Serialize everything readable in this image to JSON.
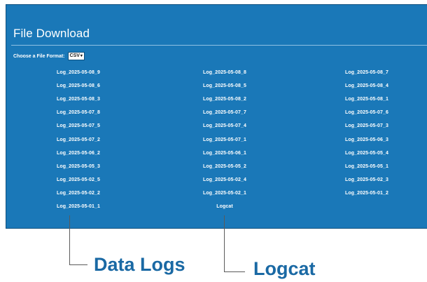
{
  "panel": {
    "title": "File Download",
    "format_label": "Choose a File Format:",
    "format_value": "CSV",
    "format_chevron": "▾"
  },
  "logs": [
    "Log_2025-05-08_9",
    "Log_2025-05-08_8",
    "Log_2025-05-08_7",
    "Log_2025-05-08_6",
    "Log_2025-05-08_5",
    "Log_2025-05-08_4",
    "Log_2025-05-08_3",
    "Log_2025-05-08_2",
    "Log_2025-05-08_1",
    "Log_2025-05-07_8",
    "Log_2025-05-07_7",
    "Log_2025-05-07_6",
    "Log_2025-05-07_5",
    "Log_2025-05-07_4",
    "Log_2025-05-07_3",
    "Log_2025-05-07_2",
    "Log_2025-05-07_1",
    "Log_2025-05-06_3",
    "Log_2025-05-06_2",
    "Log_2025-05-06_1",
    "Log_2025-05-05_4",
    "Log_2025-05-05_3",
    "Log_2025-05-05_2",
    "Log_2025-05-05_1",
    "Log_2025-05-02_5",
    "Log_2025-05-02_4",
    "Log_2025-05-02_3",
    "Log_2025-05-02_2",
    "Log_2025-05-02_1",
    "Log_2025-05-01_2",
    "Log_2025-05-01_1",
    "Logcat"
  ],
  "annotations": {
    "data_logs": "Data Logs",
    "logcat": "Logcat"
  },
  "colors": {
    "panel_bg": "#1a78b8",
    "callout_text": "#1a69a4"
  }
}
